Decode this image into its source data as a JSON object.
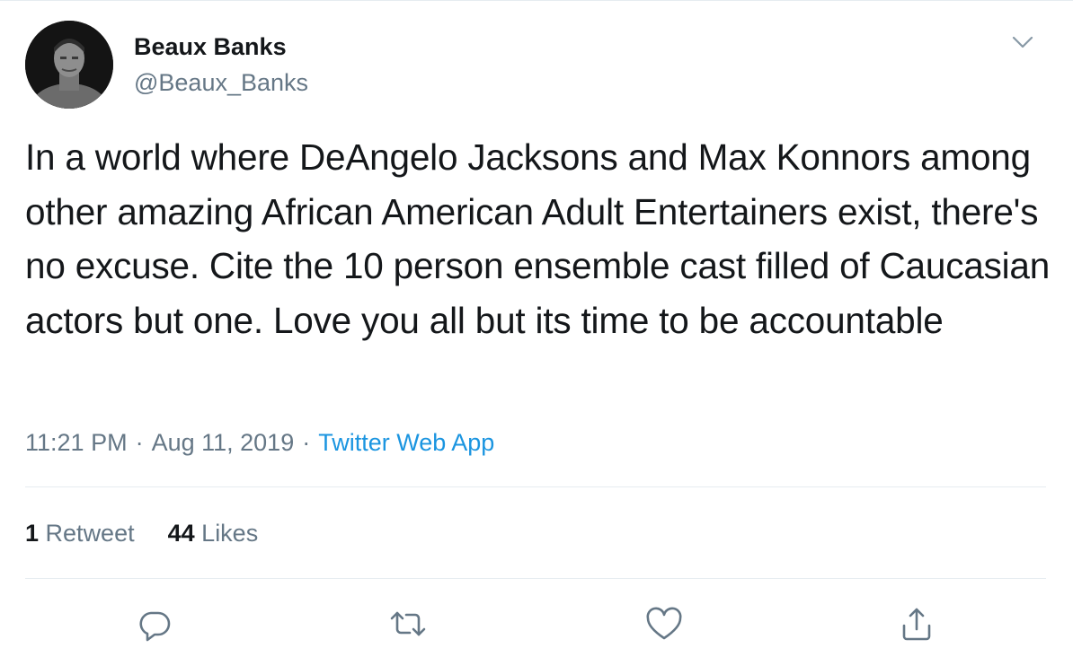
{
  "tweet": {
    "author": {
      "name": "Beaux Banks",
      "handle": "@Beaux_Banks"
    },
    "text": "In a world where DeAngelo Jacksons and Max Konnors among other amazing African American Adult Entertainers exist, there's no excuse. Cite the 10 person ensemble cast filled of Caucasian actors but one. Love you all but its time to be accountable",
    "time": "11:21 PM",
    "separator": "·",
    "date": "Aug 11, 2019",
    "source": "Twitter Web App",
    "stats": {
      "retweets_count": "1",
      "retweets_label": "Retweet",
      "likes_count": "44",
      "likes_label": "Likes"
    },
    "actions": {
      "reply_icon": "reply-icon",
      "retweet_icon": "retweet-icon",
      "like_icon": "heart-icon",
      "share_icon": "share-icon"
    }
  },
  "colors": {
    "text_primary": "#14171a",
    "text_secondary": "#657786",
    "link": "#1b95e0",
    "divider": "#e6ecf0"
  }
}
